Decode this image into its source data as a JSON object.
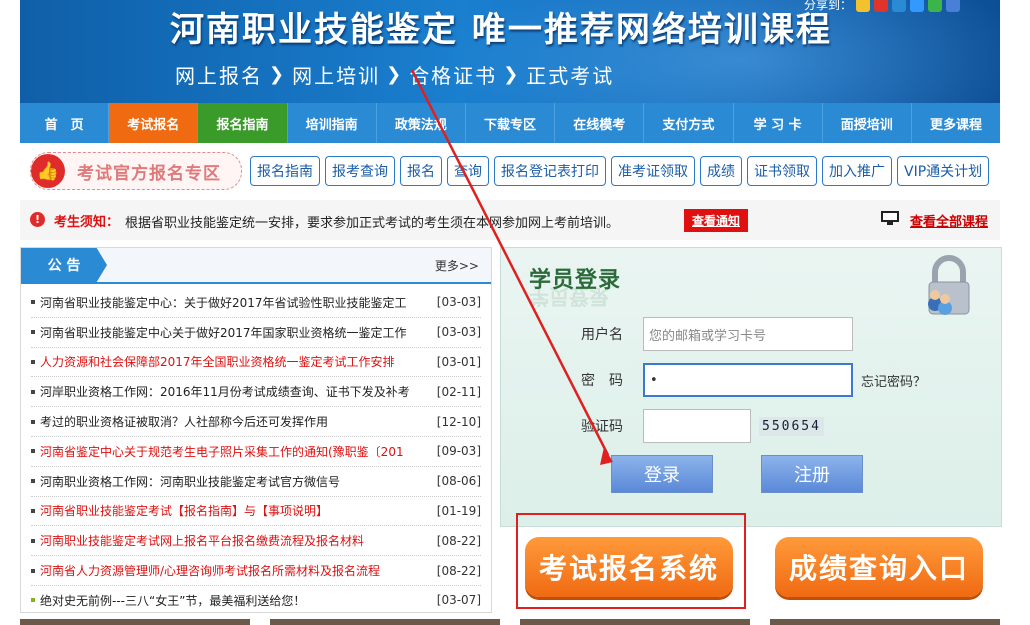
{
  "banner": {
    "title": "河南职业技能鉴定 唯一推荐网络培训课程",
    "steps": [
      "网上报名",
      "网上培训",
      "合格证书",
      "正式考试"
    ],
    "share_label": "分享到："
  },
  "nav": {
    "items": [
      {
        "label": "首　页",
        "style": "normal"
      },
      {
        "label": "考试报名",
        "style": "orange"
      },
      {
        "label": "报名指南",
        "style": "green"
      },
      {
        "label": "培训指南",
        "style": "normal"
      },
      {
        "label": "政策法规",
        "style": "normal"
      },
      {
        "label": "下载专区",
        "style": "normal"
      },
      {
        "label": "在线模考",
        "style": "normal"
      },
      {
        "label": "支付方式",
        "style": "normal"
      },
      {
        "label": "学 习 卡",
        "style": "normal"
      },
      {
        "label": "面授培训",
        "style": "normal"
      },
      {
        "label": "更多课程",
        "style": "normal"
      }
    ]
  },
  "quick": {
    "official_label": "考试官方报名专区",
    "buttons": [
      "报名指南",
      "报考查询",
      "报名",
      "查询",
      "报名登记表打印",
      "准考证领取",
      "成绩",
      "证书领取",
      "加入推广",
      "VIP通关计划"
    ]
  },
  "notice": {
    "label": "考生须知：",
    "text": "根据省职业技能鉴定统一安排，要求参加正式考试的考生须在本网参加网上考前培训。",
    "view_button": "查看通知",
    "view_all": "查看全部课程"
  },
  "announcements": {
    "tab": "公  告",
    "more": "更多>>",
    "items": [
      {
        "title": "河南省职业技能鉴定中心：关于做好2017年省试验性职业技能鉴定工",
        "date": "[03-03]",
        "style": "normal"
      },
      {
        "title": "河南省职业技能鉴定中心关于做好2017年国家职业资格统一鉴定工作",
        "date": "[03-03]",
        "style": "normal"
      },
      {
        "title": "人力资源和社会保障部2017年全国职业资格统一鉴定考试工作安排",
        "date": "[03-01]",
        "style": "red"
      },
      {
        "title": "河岸职业资格工作网：2016年11月份考试成绩查询、证书下发及补考",
        "date": "[02-11]",
        "style": "normal"
      },
      {
        "title": "考过的职业资格证被取消？人社部称今后还可发挥作用",
        "date": "[12-10]",
        "style": "normal"
      },
      {
        "title": "河南省鉴定中心关于规范考生电子照片采集工作的通知(豫职鉴〔201",
        "date": "[09-03]",
        "style": "red"
      },
      {
        "title": "河南职业资格工作网：河南职业技能鉴定考试官方微信号",
        "date": "[08-06]",
        "style": "normal"
      },
      {
        "title": "河南省职业技能鉴定考试【报名指南】与【事项说明】",
        "date": "[01-19]",
        "style": "red"
      },
      {
        "title": "河南职业技能鉴定考试网上报名平台报名缴费流程及报名材料",
        "date": "[08-22]",
        "style": "red"
      },
      {
        "title": "河南省人力资源管理师/心理咨询师考试报名所需材料及报名流程",
        "date": "[08-22]",
        "style": "red"
      },
      {
        "title": "绝对史无前例---三八“女王”节，最美福利送给您！",
        "date": "[03-07]",
        "style": "green"
      }
    ]
  },
  "login": {
    "title": "学员登录",
    "username_label": "用户名",
    "username_placeholder": "您的邮箱或学习卡号",
    "password_label": "密　码",
    "password_value": "•",
    "forgot": "忘记密码？",
    "captcha_label": "验证码",
    "captcha_value": "550654",
    "login_button": "登录",
    "register_button": "注册"
  },
  "big_buttons": {
    "exam_signup": "考试报名系统",
    "score_query": "成绩查询入口"
  },
  "colors": {
    "nav_blue": "#2a8ad4",
    "orange": "#f06a12",
    "green": "#3a9a2a",
    "alert_red": "#e02020"
  }
}
